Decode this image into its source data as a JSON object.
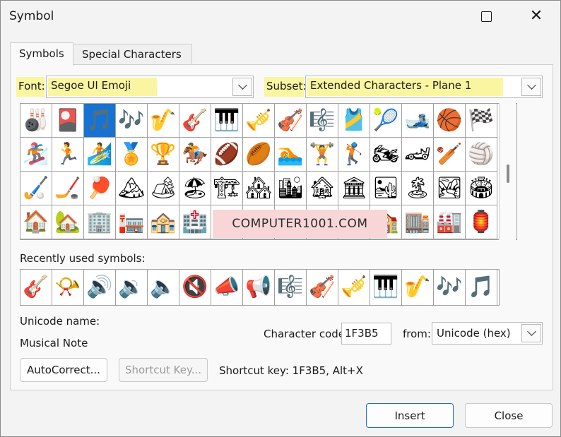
{
  "window": {
    "title": "Symbol"
  },
  "tabs": [
    {
      "label": "Symbols",
      "mnemonic": "S"
    },
    {
      "label": "Special Characters",
      "mnemonic": "P"
    }
  ],
  "font": {
    "label": "Font:",
    "value": "Segoe UI Emoji"
  },
  "subset": {
    "label": "Subset:",
    "value": "Extended Characters - Plane 1"
  },
  "symbol_grid": {
    "selected_index": 2,
    "rows": [
      [
        "🎳",
        "🎴",
        "🎵",
        "🎶",
        "🎷",
        "🎸",
        "🎹",
        "🎺",
        "🎻",
        "🎼",
        "🎽",
        "🎾",
        "🎿",
        "🏀",
        "🏁"
      ],
      [
        "🏂",
        "🏃",
        "🏄",
        "🏅",
        "🏆",
        "🏇",
        "🏈",
        "🏉",
        "🏊",
        "🏋",
        "🏌",
        "🏍",
        "🏎",
        "🏏",
        "🏐"
      ],
      [
        "🏑",
        "🏒",
        "🏓",
        "🏔",
        "🏕",
        "🏖",
        "🏗",
        "🏘",
        "🏙",
        "🏚",
        "🏛",
        "🏜",
        "🏝",
        "🏞",
        "🏟"
      ],
      [
        "🏠",
        "🏡",
        "🏢",
        "🏣",
        "🏤",
        "🏥",
        "🏦",
        "🏧",
        "🏨",
        "🏩",
        "🏪",
        "🏫",
        "🏬",
        "🏭",
        "🏮"
      ]
    ]
  },
  "watermark": "COMPUTER1001.COM",
  "recent": {
    "label": "Recently used symbols:",
    "symbols": [
      "🎸",
      "📯",
      "🔊",
      "🔉",
      "🔈",
      "🔇",
      "📣",
      "📢",
      "🎼",
      "🎻",
      "🎺",
      "🎹",
      "🎷",
      "🎶",
      "🎵"
    ]
  },
  "unicode_name": {
    "label": "Unicode name:",
    "value": "Musical Note"
  },
  "character_code": {
    "label": "Character code:",
    "value": "1F3B5"
  },
  "from": {
    "label": "from:",
    "value": "Unicode (hex)"
  },
  "buttons": {
    "autocorrect": "AutoCorrect...",
    "shortcut_key": "Shortcut Key...",
    "insert": "Insert",
    "close": "Close"
  },
  "shortcut_text": "Shortcut key: 1F3B5, Alt+X"
}
